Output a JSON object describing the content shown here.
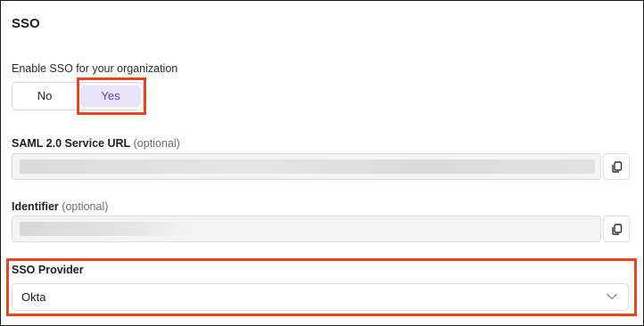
{
  "section": {
    "title": "SSO"
  },
  "enable_sso": {
    "label": "Enable SSO for your organization",
    "options": [
      "No",
      "Yes"
    ],
    "selected": "Yes"
  },
  "saml_url": {
    "label": "SAML 2.0 Service URL",
    "optional": "(optional)",
    "value_state": "redacted",
    "copy_icon": "copy-icon"
  },
  "identifier": {
    "label": "Identifier",
    "optional": "(optional)",
    "value_state": "redacted",
    "copy_icon": "copy-icon"
  },
  "sso_provider": {
    "label": "SSO Provider",
    "value": "Okta",
    "icon": "chevron-down-icon"
  },
  "colors": {
    "accent": "#5b3fc4",
    "selected_bg": "#e9e3fb",
    "highlight": "#e5461d",
    "field_bg": "#f4f4f6"
  }
}
